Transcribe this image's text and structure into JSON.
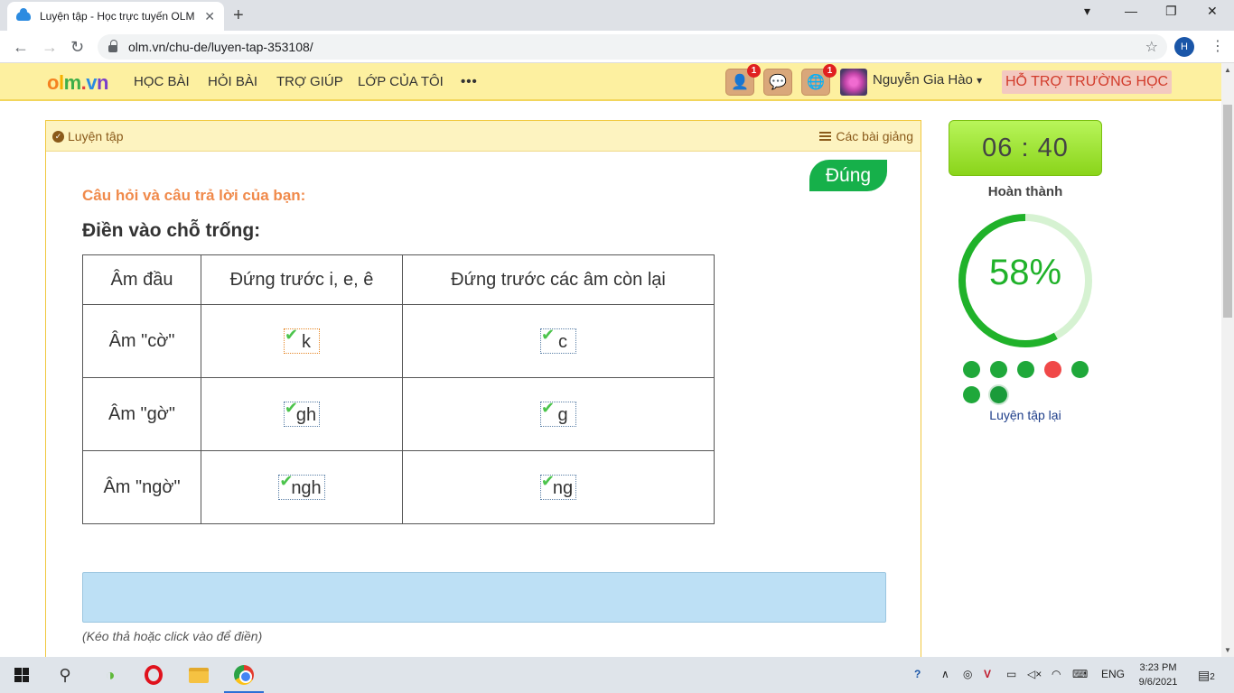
{
  "browser": {
    "tab_title": "Luyện tập - Học trực tuyến OLM",
    "tab_close": "✕",
    "new_tab": "+",
    "url": "olm.vn/chu-de/luyen-tap-353108/",
    "profile_initial": "H",
    "window_controls": [
      "▾",
      "—",
      "❐",
      "✕"
    ]
  },
  "site": {
    "logo_parts": [
      "o",
      "l",
      "m",
      ".",
      "v",
      "n"
    ],
    "menu": [
      "HỌC BÀI",
      "HỎI BÀI",
      "TRỢ GIÚP",
      "LỚP CỦA TÔI",
      "•••"
    ],
    "icons": [
      {
        "name": "add-friend-icon",
        "badge": "1"
      },
      {
        "name": "chat-icon",
        "badge": ""
      },
      {
        "name": "globe-notification-icon",
        "badge": "1"
      }
    ],
    "user_name": "Nguyễn Gia Hào",
    "user_caret": "▾",
    "support": "HỖ TRỢ TRƯỜNG HỌC"
  },
  "card": {
    "header_left": "Luyện tập",
    "header_right": "Các bài giảng",
    "status": "Đúng",
    "question_label": "Câu hỏi và câu trả lời của bạn:",
    "instruction": "Điền vào chỗ trống:",
    "table": {
      "headers": [
        "Âm đầu",
        "Đứng trước i, e, ê",
        "Đứng trước các âm còn lại"
      ],
      "rows": [
        {
          "label": "Âm \"cờ\"",
          "a": "k",
          "b": "c"
        },
        {
          "label": "Âm \"gờ\"",
          "a": "gh",
          "b": "g"
        },
        {
          "label": "Âm \"ngờ\"",
          "a": "ngh",
          "b": "ng"
        }
      ]
    },
    "hint": "(Kéo thả hoặc click vào để điền)"
  },
  "panel": {
    "timer": "06 : 40",
    "done_label": "Hoàn thành",
    "progress_percent": 58,
    "progress_text": "58%",
    "question_dots": [
      "green",
      "green",
      "green",
      "red",
      "green",
      "green",
      "current"
    ],
    "retry": "Luyện tập lại"
  },
  "taskbar": {
    "lang": "ENG",
    "time": "3:23 PM",
    "date": "9/6/2021",
    "notif_count": "2"
  },
  "colors": {
    "accent_green": "#20b22a",
    "status_green": "#16b04a",
    "question_orange": "#f08a4b",
    "support_red": "#d23b2b"
  }
}
